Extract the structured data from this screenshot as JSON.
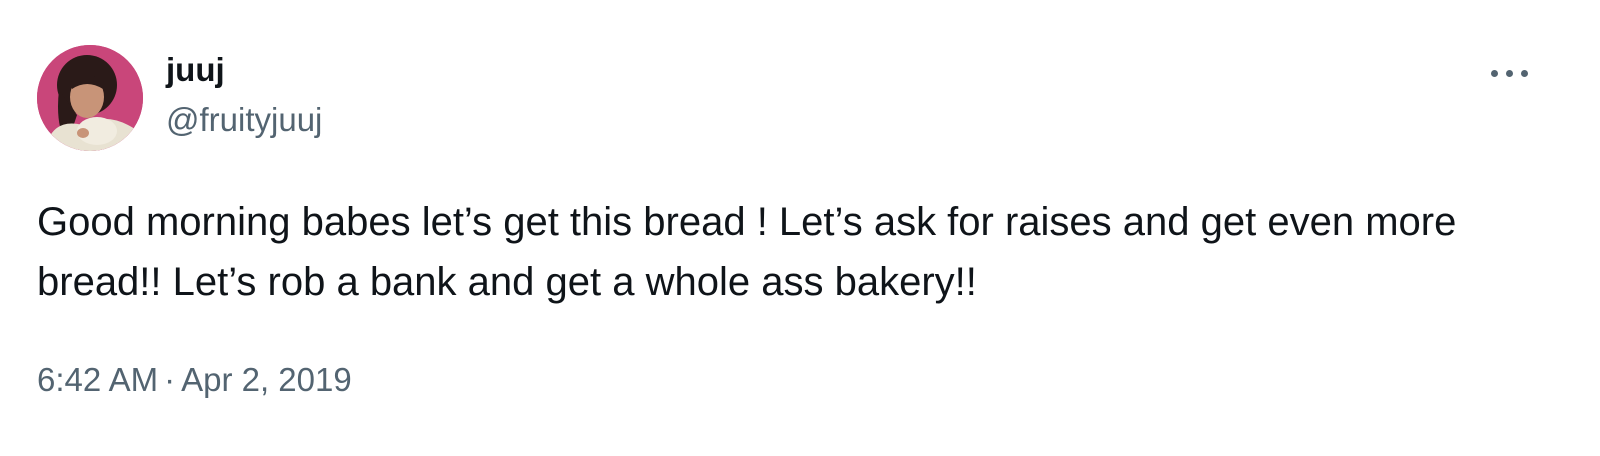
{
  "author": {
    "display_name": "juuj",
    "handle": "@fruityjuuj",
    "avatar_icon": "profile-photo"
  },
  "more_icon": "more-horizontal-icon",
  "tweet": {
    "text": "Good morning babes let’s get this bread ! Let’s ask for raises and get even more bread!! Let’s rob a bank and get a whole ass bakery!!",
    "time": "6:42 AM",
    "separator": "·",
    "date": "Apr 2, 2019"
  },
  "colors": {
    "primary_text": "#0f1419",
    "secondary_text": "#536471",
    "avatar_background": "#c9467a"
  }
}
